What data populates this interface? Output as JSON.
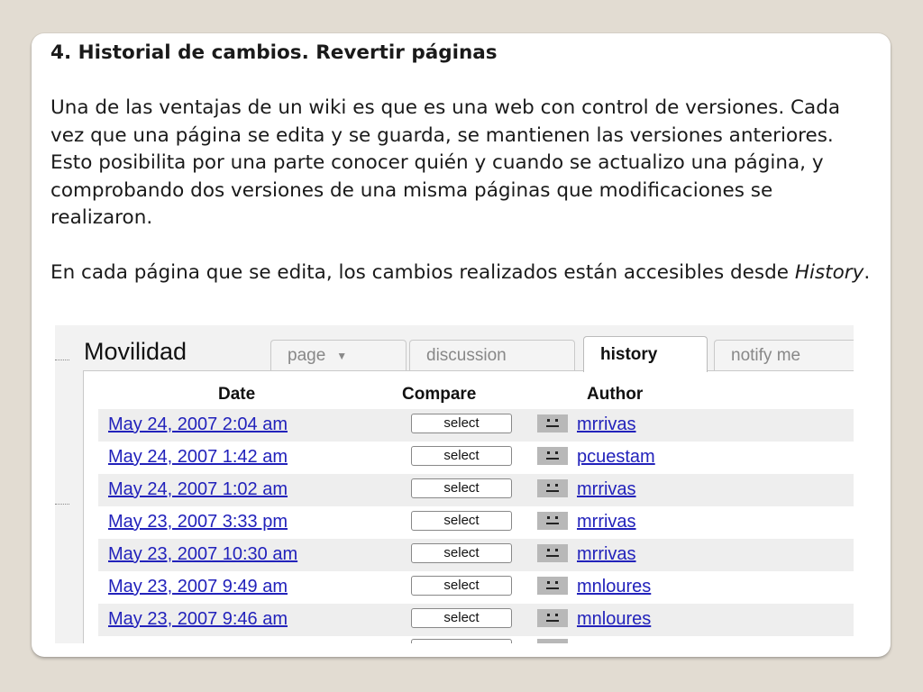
{
  "heading": "4. Historial de cambios. Revertir páginas",
  "para1": "Una de las ventajas de un wiki es que es una web con control de versiones. Cada vez que una página se edita y se guarda, se mantienen las versiones anteriores. Esto posibilita por una parte conocer quién y cuando se actualizo una página, y comprobando dos versiones de una misma páginas que modificaciones se realizaron.",
  "para2_before": "En cada página que se edita, los cambios realizados están accesibles desde ",
  "para2_emph": "History",
  "para2_after": ".",
  "screenshot": {
    "page_title": "Movilidad",
    "tabs": [
      "page",
      "discussion",
      "history",
      "notify me"
    ],
    "active_tab": "history",
    "columns": [
      "Date",
      "Compare",
      "Author"
    ],
    "select_label": "select",
    "rows": [
      {
        "date": "May 24, 2007 2:04 am",
        "author": "mrrivas"
      },
      {
        "date": "May 24, 2007 1:42 am",
        "author": "pcuestam"
      },
      {
        "date": "May 24, 2007 1:02 am",
        "author": "mrrivas"
      },
      {
        "date": "May 23, 2007 3:33 pm",
        "author": "mrrivas"
      },
      {
        "date": "May 23, 2007 10:30 am",
        "author": "mrrivas"
      },
      {
        "date": "May 23, 2007 9:49 am",
        "author": "mnloures"
      },
      {
        "date": "May 23, 2007 9:46 am",
        "author": "mnloures"
      }
    ]
  }
}
